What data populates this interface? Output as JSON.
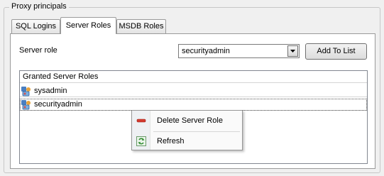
{
  "group": {
    "title": "Proxy principals"
  },
  "tabs": [
    {
      "label": "SQL Logins",
      "active": false
    },
    {
      "label": "Server Roles",
      "active": true
    },
    {
      "label": "MSDB Roles",
      "active": false
    }
  ],
  "server_role": {
    "label": "Server role",
    "selected": "securityadmin",
    "add_button": "Add To List"
  },
  "granted_list": {
    "header": "Granted Server Roles",
    "rows": [
      {
        "label": "sysadmin",
        "icon": "server-role-icon"
      },
      {
        "label": "securityadmin",
        "icon": "server-role-icon",
        "selected": true
      }
    ]
  },
  "context_menu": {
    "items": [
      {
        "label": "Delete Server Role",
        "icon": "delete-icon"
      },
      {
        "label": "Refresh",
        "icon": "refresh-icon"
      }
    ]
  }
}
